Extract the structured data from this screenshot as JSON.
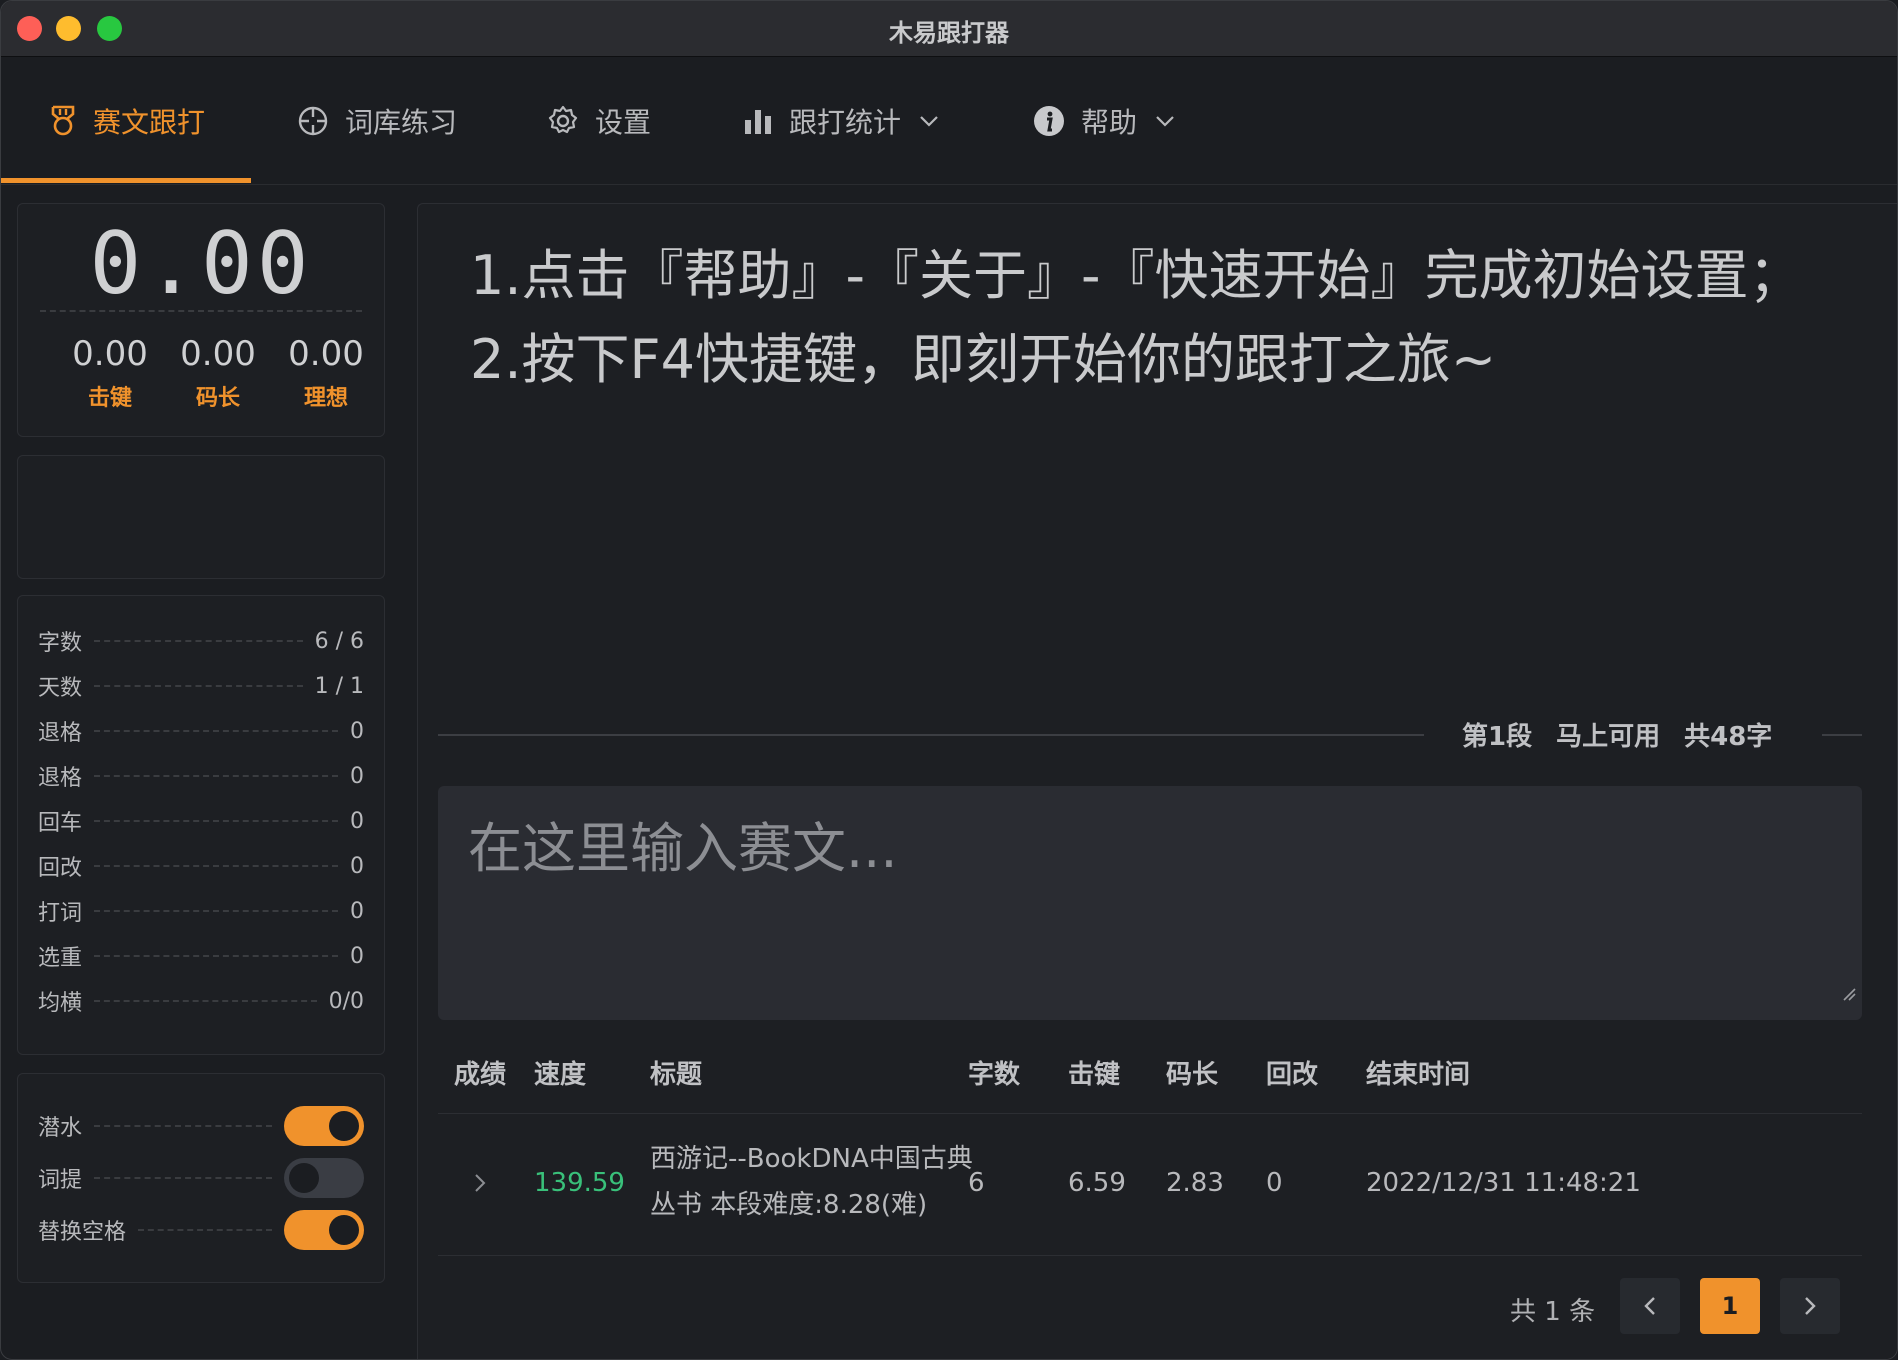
{
  "window": {
    "title": "木易跟打器"
  },
  "nav": {
    "items": [
      {
        "label": "赛文跟打",
        "icon": "medal-icon",
        "active": true
      },
      {
        "label": "词库练习",
        "icon": "crosshair-icon"
      },
      {
        "label": "设置",
        "icon": "gear-icon"
      },
      {
        "label": "跟打统计",
        "icon": "bar-chart-icon",
        "dropdown": true
      },
      {
        "label": "帮助",
        "icon": "info-icon",
        "dropdown": true
      }
    ]
  },
  "speed_panel": {
    "speed": "0.00",
    "metrics": [
      {
        "value": "0.00",
        "label": "击键"
      },
      {
        "value": "0.00",
        "label": "码长"
      },
      {
        "value": "0.00",
        "label": "理想"
      }
    ]
  },
  "stats": [
    {
      "key": "字数",
      "value": "6 / 6"
    },
    {
      "key": "天数",
      "value": "1 / 1"
    },
    {
      "key": "退格",
      "value": "0"
    },
    {
      "key": "退格",
      "value": "0"
    },
    {
      "key": "回车",
      "value": "0"
    },
    {
      "key": "回改",
      "value": "0"
    },
    {
      "key": "打词",
      "value": "0"
    },
    {
      "key": "选重",
      "value": "0"
    },
    {
      "key": "均横",
      "value": "0/0"
    }
  ],
  "toggles": [
    {
      "key": "潜水",
      "on": true
    },
    {
      "key": "词提",
      "on": false
    },
    {
      "key": "替换空格",
      "on": true
    }
  ],
  "passage": {
    "text": "1.点击『帮助』-『关于』-『快速开始』完成初始设置；2.按下F4快捷键，即刻开始你的跟打之旅~"
  },
  "segment": {
    "index": "第1段",
    "status": "马上可用",
    "total": "共48字"
  },
  "input": {
    "placeholder": "在这里输入赛文..."
  },
  "table": {
    "headers": [
      "成绩",
      "速度",
      "标题",
      "字数",
      "击键",
      "码长",
      "回改",
      "结束时间"
    ],
    "rows": [
      {
        "speed": "139.59",
        "title_line1": "西游记--BookDNA中国古典",
        "title_line2": "丛书 本段难度:8.28(难)",
        "chars": "6",
        "keystroke": "6.59",
        "code_len": "2.83",
        "corrections": "0",
        "end_time": "2022/12/31 11:48:21"
      }
    ]
  },
  "pagination": {
    "total": "共 1 条",
    "current": "1"
  },
  "colors": {
    "accent": "#f0922c",
    "speed_green": "#39c07a",
    "background": "#1b1d21"
  }
}
